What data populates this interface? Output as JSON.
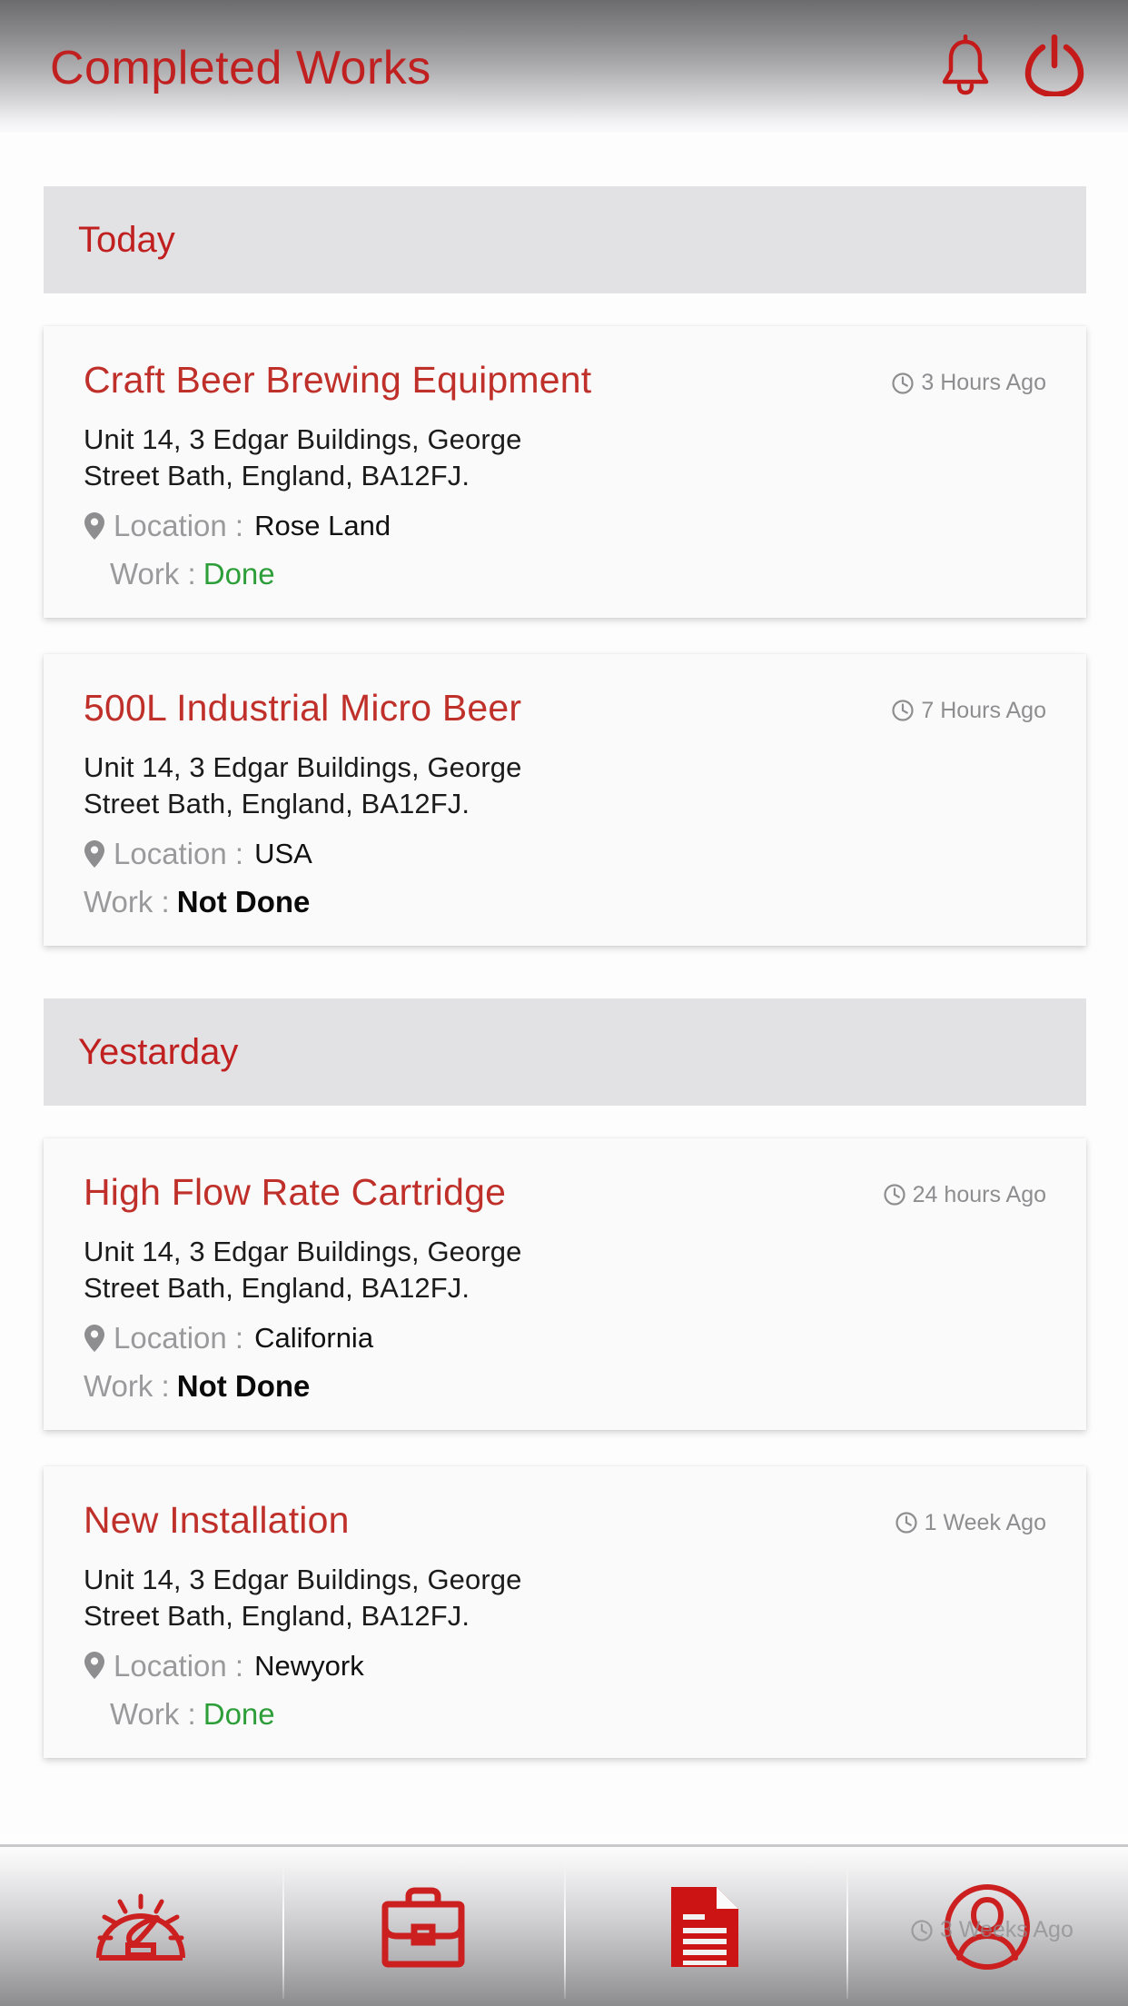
{
  "header": {
    "title": "Completed Works",
    "accent_color": "#C02020",
    "notifications_icon": "bell-icon",
    "power_icon": "power-icon"
  },
  "sections": [
    {
      "label": "Today",
      "cards": [
        {
          "title": "Craft Beer Brewing Equipment",
          "timestamp": "3 Hours Ago",
          "address_line1": "Unit 14, 3 Edgar Buildings, George",
          "address_line2": "Street Bath, England, BA12FJ.",
          "location_label": "Location :",
          "location_value": "Rose Land",
          "work_label": "Work :",
          "work_value": "Done",
          "work_status": "done"
        },
        {
          "title": "500L Industrial Micro Beer",
          "timestamp": "7 Hours Ago",
          "address_line1": "Unit 14, 3 Edgar Buildings, George",
          "address_line2": "Street Bath, England, BA12FJ.",
          "location_label": "Location :",
          "location_value": "USA",
          "work_label": "Work :",
          "work_value": "Not Done",
          "work_status": "not-done"
        }
      ]
    },
    {
      "label": "Yestarday",
      "cards": [
        {
          "title": "High Flow Rate Cartridge",
          "timestamp": "24 hours Ago",
          "address_line1": "Unit 14, 3 Edgar Buildings, George",
          "address_line2": "Street Bath, England, BA12FJ.",
          "location_label": "Location :",
          "location_value": "California",
          "work_label": "Work :",
          "work_value": "Not Done",
          "work_status": "not-done"
        },
        {
          "title": "New Installation",
          "timestamp": "1 Week Ago",
          "address_line1": "Unit 14, 3 Edgar Buildings, George",
          "address_line2": "Street Bath, England, BA12FJ.",
          "location_label": "Location :",
          "location_value": "Newyork",
          "work_label": "Work :",
          "work_value": "Done",
          "work_status": "done"
        }
      ]
    }
  ],
  "partial_item": {
    "timestamp": "3 Weeks Ago"
  },
  "bottom_nav": {
    "items": [
      {
        "icon": "speedometer-icon",
        "name": "dashboard"
      },
      {
        "icon": "briefcase-icon",
        "name": "works"
      },
      {
        "icon": "document-icon",
        "name": "reports"
      },
      {
        "icon": "profile-icon",
        "name": "profile"
      }
    ],
    "accent_color": "#CC1F1F"
  },
  "colors": {
    "title_red": "#C02020",
    "card_title_red": "#C0302A",
    "done_green": "#2E9E3A",
    "label_gray": "#9A9A9C",
    "section_bg": "#E2E2E4"
  }
}
